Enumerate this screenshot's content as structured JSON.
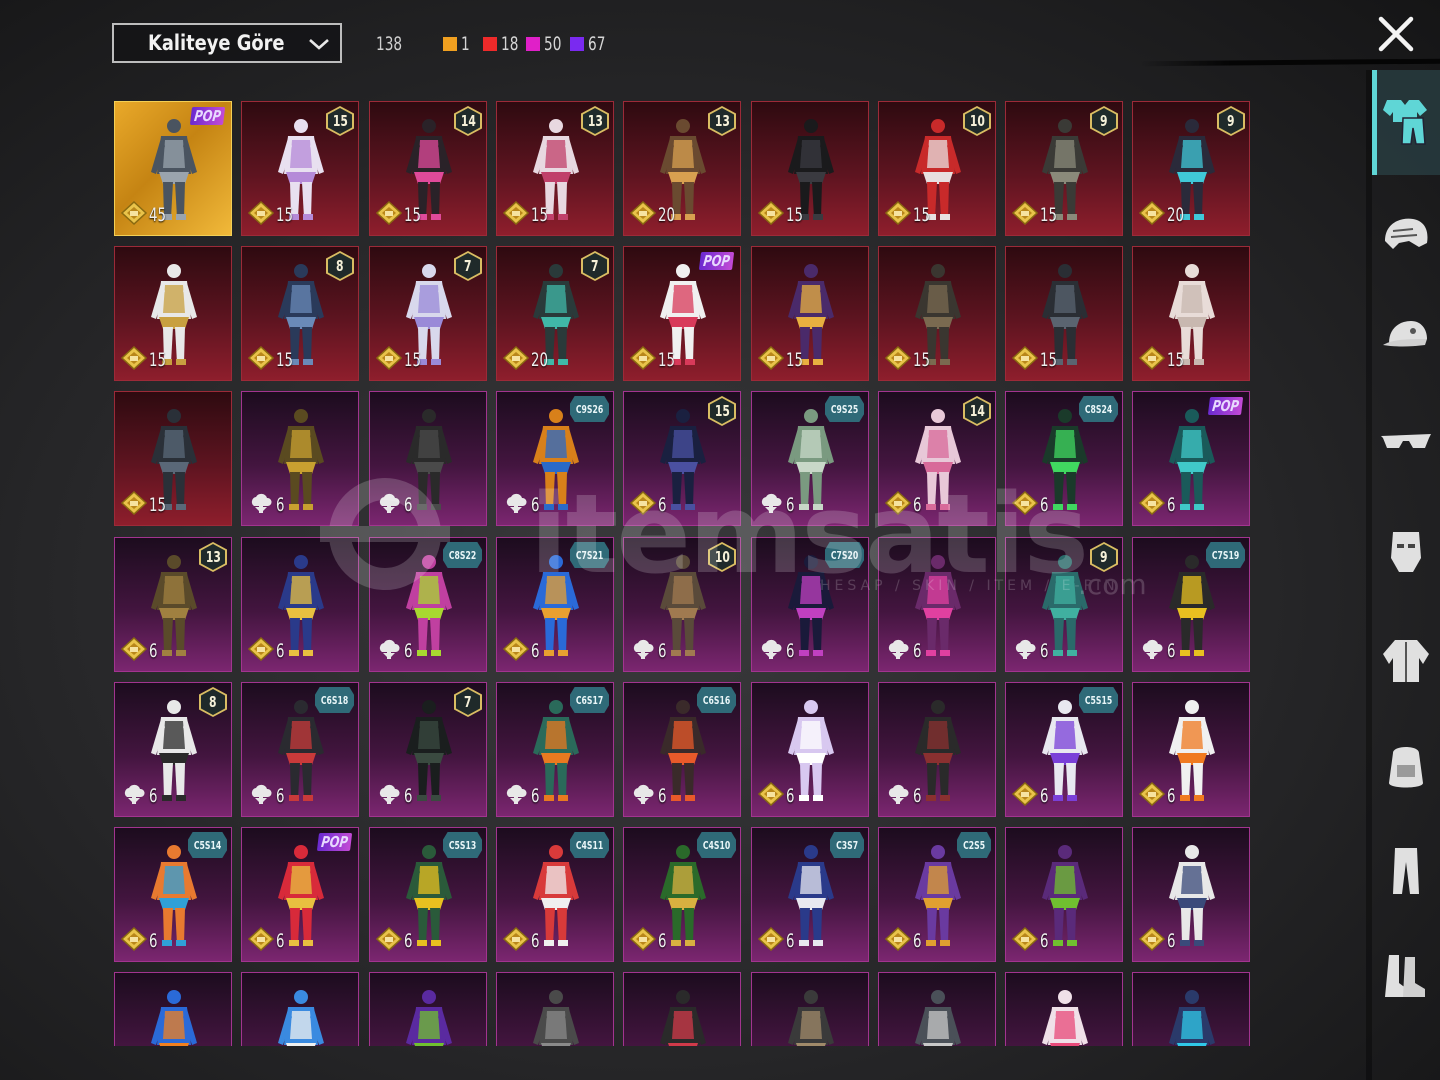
{
  "header": {
    "sort_label": "Kaliteye Göre",
    "total": "138",
    "quality_counts": [
      {
        "color": "#f0a020",
        "count": "1"
      },
      {
        "color": "#ee2a2a",
        "count": "18"
      },
      {
        "color": "#e020c8",
        "count": "50"
      },
      {
        "color": "#7a2af0",
        "count": "67"
      }
    ]
  },
  "watermark": {
    "main": "itemsatis",
    "sub": "HESAP / SKIN / ITEM / E-PIN",
    "suffix": ".com"
  },
  "sidebar": {
    "items": [
      {
        "icon": "outfit-icon",
        "active": true
      },
      {
        "icon": "helmet-icon",
        "active": false
      },
      {
        "icon": "cap-icon",
        "active": false
      },
      {
        "icon": "glasses-icon",
        "active": false
      },
      {
        "icon": "mask-icon",
        "active": false
      },
      {
        "icon": "jacket-icon",
        "active": false
      },
      {
        "icon": "backpack-icon",
        "active": false
      },
      {
        "icon": "pants-icon",
        "active": false
      },
      {
        "icon": "shoes-icon",
        "active": false
      }
    ]
  },
  "items": [
    {
      "q": "gold",
      "badge": "pop",
      "cost": "45",
      "cur": "gold",
      "c1": "#4a5460",
      "c2": "#9aa4ae"
    },
    {
      "q": "red",
      "badge": "15",
      "cost": "15",
      "cur": "gold",
      "c1": "#e8e0f0",
      "c2": "#b58ad8"
    },
    {
      "q": "red",
      "badge": "14",
      "cost": "15",
      "cur": "gold",
      "c1": "#2a2228",
      "c2": "#e04a9a"
    },
    {
      "q": "red",
      "badge": "13",
      "cost": "15",
      "cur": "gold",
      "c1": "#e8d8e0",
      "c2": "#c0406a"
    },
    {
      "q": "red",
      "badge": "13",
      "cost": "20",
      "cur": "gold",
      "c1": "#6a4a30",
      "c2": "#d8a050"
    },
    {
      "q": "red",
      "badge": "",
      "cost": "15",
      "cur": "gold",
      "c1": "#1a1a1c",
      "c2": "#3a3a40"
    },
    {
      "q": "red",
      "badge": "10",
      "cost": "15",
      "cur": "gold",
      "c1": "#c82a2a",
      "c2": "#e8e0e0"
    },
    {
      "q": "red",
      "badge": "9",
      "cost": "15",
      "cur": "gold",
      "c1": "#3a3a36",
      "c2": "#8a8a7a"
    },
    {
      "q": "red",
      "badge": "9",
      "cost": "20",
      "cur": "gold",
      "c1": "#2a2a3a",
      "c2": "#40c8d8"
    },
    {
      "q": "red",
      "badge": "",
      "cost": "15",
      "cur": "gold",
      "c1": "#e8e8e8",
      "c2": "#c8a040"
    },
    {
      "q": "red",
      "badge": "8",
      "cost": "15",
      "cur": "gold",
      "c1": "#2a3a5a",
      "c2": "#6a8ab8"
    },
    {
      "q": "red",
      "badge": "7",
      "cost": "15",
      "cur": "gold",
      "c1": "#d8d8ec",
      "c2": "#9a8ad8"
    },
    {
      "q": "red",
      "badge": "7",
      "cost": "20",
      "cur": "gold",
      "c1": "#2a3a3a",
      "c2": "#40b8a8"
    },
    {
      "q": "red",
      "badge": "pop",
      "cost": "15",
      "cur": "gold",
      "c1": "#f0f0f0",
      "c2": "#d83a5a"
    },
    {
      "q": "red",
      "badge": "",
      "cost": "15",
      "cur": "gold",
      "c1": "#4a2a6a",
      "c2": "#e8b040"
    },
    {
      "q": "red",
      "badge": "",
      "cost": "15",
      "cur": "gold",
      "c1": "#3a3630",
      "c2": "#7a6a50"
    },
    {
      "q": "red",
      "badge": "",
      "cost": "15",
      "cur": "gold",
      "c1": "#2a2e34",
      "c2": "#5a6470"
    },
    {
      "q": "red",
      "badge": "",
      "cost": "15",
      "cur": "gold",
      "c1": "#e8dcd8",
      "c2": "#c8b8b0"
    },
    {
      "q": "red",
      "badge": "",
      "cost": "15",
      "cur": "gold",
      "c1": "#2a3038",
      "c2": "#5a6878"
    },
    {
      "q": "purple",
      "badge": "",
      "cost": "6",
      "cur": "cloud",
      "c1": "#5a4a20",
      "c2": "#c8a030"
    },
    {
      "q": "purple",
      "badge": "",
      "cost": "6",
      "cur": "cloud",
      "c1": "#2a2a2a",
      "c2": "#4a4a4a"
    },
    {
      "q": "purple",
      "badge": "C9S26",
      "cost": "6",
      "cur": "cloud",
      "c1": "#d8801a",
      "c2": "#2a6ac8"
    },
    {
      "q": "purple",
      "badge": "15",
      "cost": "6",
      "cur": "gold",
      "c1": "#1a2040",
      "c2": "#4a50a0"
    },
    {
      "q": "purple",
      "badge": "C9S25",
      "cost": "6",
      "cur": "cloud",
      "c1": "#7a9a80",
      "c2": "#c8d8c8"
    },
    {
      "q": "purple",
      "badge": "14",
      "cost": "6",
      "cur": "gold",
      "c1": "#e8c8d8",
      "c2": "#d86a9a"
    },
    {
      "q": "purple",
      "badge": "C8S24",
      "cost": "6",
      "cur": "gold",
      "c1": "#1a3a2a",
      "c2": "#40d860"
    },
    {
      "q": "purple",
      "badge": "pop",
      "cost": "6",
      "cur": "gold",
      "c1": "#1a5a5a",
      "c2": "#40c8c8"
    },
    {
      "q": "purple",
      "badge": "13",
      "cost": "6",
      "cur": "gold",
      "c1": "#5a4a2a",
      "c2": "#a08040"
    },
    {
      "q": "purple",
      "badge": "",
      "cost": "6",
      "cur": "gold",
      "c1": "#2a3a8a",
      "c2": "#e8c040"
    },
    {
      "q": "purple",
      "badge": "C8S22",
      "cost": "6",
      "cur": "cloud",
      "c1": "#c040a0",
      "c2": "#a8d830"
    },
    {
      "q": "purple",
      "badge": "C7S21",
      "cost": "6",
      "cur": "gold",
      "c1": "#2a6ad8",
      "c2": "#e8a030"
    },
    {
      "q": "purple",
      "badge": "10",
      "cost": "6",
      "cur": "cloud",
      "c1": "#5a4a3a",
      "c2": "#a07a50"
    },
    {
      "q": "purple",
      "badge": "C7S20",
      "cost": "6",
      "cur": "cloud",
      "c1": "#1a1a3a",
      "c2": "#c040c0"
    },
    {
      "q": "purple",
      "badge": "",
      "cost": "6",
      "cur": "cloud",
      "c1": "#6a2a6a",
      "c2": "#e040a0"
    },
    {
      "q": "purple",
      "badge": "9",
      "cost": "6",
      "cur": "cloud",
      "c1": "#2a6a6a",
      "c2": "#40b0a0"
    },
    {
      "q": "purple",
      "badge": "C7S19",
      "cost": "6",
      "cur": "cloud",
      "c1": "#2a2a2a",
      "c2": "#e8c020"
    },
    {
      "q": "purple",
      "badge": "8",
      "cost": "6",
      "cur": "cloud",
      "c1": "#e8e8e8",
      "c2": "#2a2a2a"
    },
    {
      "q": "purple",
      "badge": "C6S18",
      "cost": "6",
      "cur": "cloud",
      "c1": "#2a2a30",
      "c2": "#c83a3a"
    },
    {
      "q": "purple",
      "badge": "7",
      "cost": "6",
      "cur": "cloud",
      "c1": "#1a1e1e",
      "c2": "#3a4a40"
    },
    {
      "q": "purple",
      "badge": "C6S17",
      "cost": "6",
      "cur": "cloud",
      "c1": "#2a6a5a",
      "c2": "#e87a20"
    },
    {
      "q": "purple",
      "badge": "C6S16",
      "cost": "6",
      "cur": "cloud",
      "c1": "#3a2a2a",
      "c2": "#e85a2a"
    },
    {
      "q": "purple",
      "badge": "",
      "cost": "6",
      "cur": "gold",
      "c1": "#d8c8f0",
      "c2": "#ffffff"
    },
    {
      "q": "purple",
      "badge": "",
      "cost": "6",
      "cur": "cloud",
      "c1": "#2a2a2a",
      "c2": "#8a3030"
    },
    {
      "q": "purple",
      "badge": "C5S15",
      "cost": "6",
      "cur": "gold",
      "c1": "#e8e8f0",
      "c2": "#7a40d8"
    },
    {
      "q": "purple",
      "badge": "",
      "cost": "6",
      "cur": "gold",
      "c1": "#f0f0f0",
      "c2": "#f07a20"
    },
    {
      "q": "purple",
      "badge": "C5S14",
      "cost": "6",
      "cur": "gold",
      "c1": "#e87a30",
      "c2": "#30a0d8"
    },
    {
      "q": "purple",
      "badge": "pop",
      "cost": "6",
      "cur": "gold",
      "c1": "#d82a3a",
      "c2": "#e8c040"
    },
    {
      "q": "purple",
      "badge": "C5S13",
      "cost": "6",
      "cur": "gold",
      "c1": "#2a5a3a",
      "c2": "#e8c020"
    },
    {
      "q": "purple",
      "badge": "C4S11",
      "cost": "6",
      "cur": "gold",
      "c1": "#d83a3a",
      "c2": "#f0f0f0"
    },
    {
      "q": "purple",
      "badge": "C4S10",
      "cost": "6",
      "cur": "gold",
      "c1": "#2a6a2a",
      "c2": "#d8b040"
    },
    {
      "q": "purple",
      "badge": "C3S7",
      "cost": "6",
      "cur": "gold",
      "c1": "#2a3a8a",
      "c2": "#e8e8f0"
    },
    {
      "q": "purple",
      "badge": "C2S5",
      "cost": "6",
      "cur": "gold",
      "c1": "#6a3aa0",
      "c2": "#e0a030"
    },
    {
      "q": "purple",
      "badge": "",
      "cost": "6",
      "cur": "gold",
      "c1": "#5a2a7a",
      "c2": "#70c030"
    },
    {
      "q": "purple",
      "badge": "",
      "cost": "6",
      "cur": "gold",
      "c1": "#e8e8e8",
      "c2": "#3a4a7a"
    },
    {
      "q": "purple",
      "badge": "",
      "cost": "",
      "cur": "",
      "c1": "#2a6ad8",
      "c2": "#f08020"
    },
    {
      "q": "purple",
      "badge": "",
      "cost": "",
      "cur": "",
      "c1": "#3a8ae0",
      "c2": "#f0f0f0"
    },
    {
      "q": "purple",
      "badge": "",
      "cost": "",
      "cur": "",
      "c1": "#5a2aa0",
      "c2": "#70c030"
    },
    {
      "q": "purple",
      "badge": "",
      "cost": "",
      "cur": "",
      "c1": "#4a4a4a",
      "c2": "#8a8a8a"
    },
    {
      "q": "purple",
      "badge": "",
      "cost": "",
      "cur": "",
      "c1": "#2a2a2a",
      "c2": "#d03a4a"
    },
    {
      "q": "purple",
      "badge": "",
      "cost": "",
      "cur": "",
      "c1": "#3a3a3a",
      "c2": "#a08a6a"
    },
    {
      "q": "purple",
      "badge": "",
      "cost": "",
      "cur": "",
      "c1": "#4a5058",
      "c2": "#c8c8c8"
    },
    {
      "q": "purple",
      "badge": "",
      "cost": "",
      "cur": "",
      "c1": "#f0e0e8",
      "c2": "#e84a7a"
    },
    {
      "q": "purple",
      "badge": "",
      "cost": "",
      "cur": "",
      "c1": "#2a3a6a",
      "c2": "#30c8e8"
    }
  ]
}
